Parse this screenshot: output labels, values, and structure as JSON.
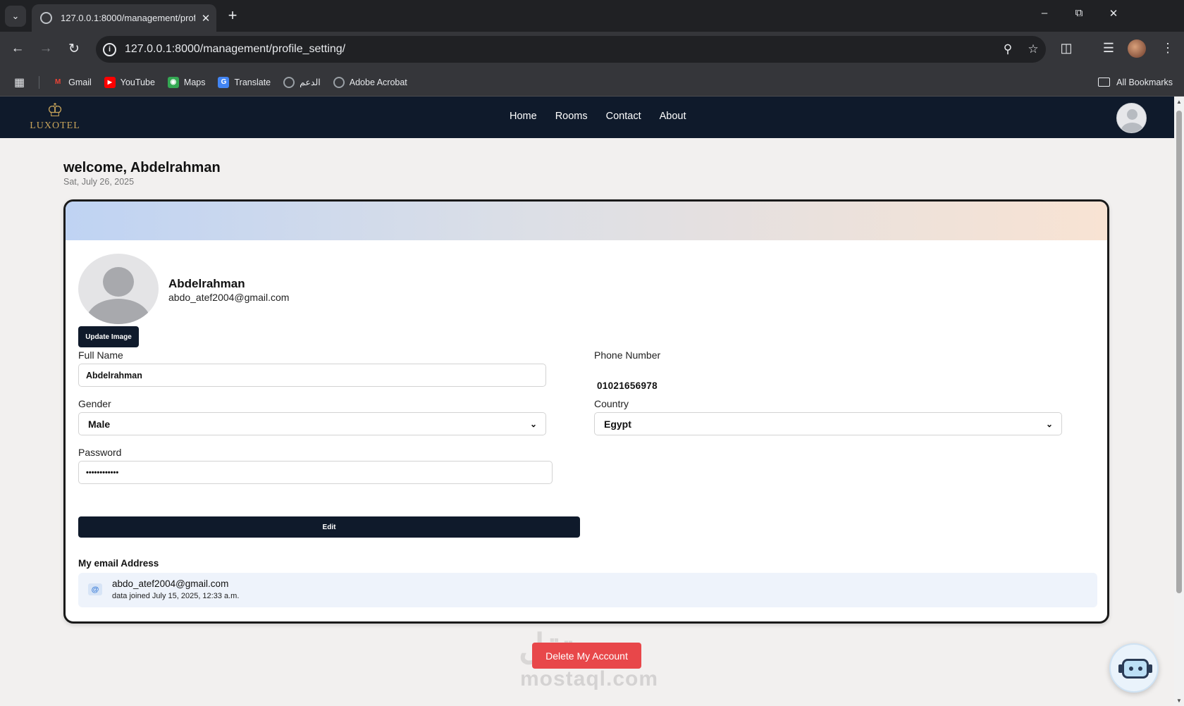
{
  "browser": {
    "tab_title": "127.0.0.1:8000/management/profile_setting/",
    "url": "127.0.0.1:8000/management/profile_setting/",
    "bookmarks": [
      {
        "label": "Gmail",
        "icon": "gmail-icon",
        "color": "#ea4335"
      },
      {
        "label": "YouTube",
        "icon": "youtube-icon",
        "color": "#ff0000"
      },
      {
        "label": "Maps",
        "icon": "maps-icon",
        "color": "#34a853"
      },
      {
        "label": "Translate",
        "icon": "translate-icon",
        "color": "#4285f4"
      },
      {
        "label": "الدعم",
        "icon": "globe-icon",
        "color": "#9aa0a6"
      },
      {
        "label": "Adobe Acrobat",
        "icon": "globe-icon",
        "color": "#9aa0a6"
      }
    ],
    "all_bookmarks": "All Bookmarks"
  },
  "site": {
    "logo_text": "LUXOTEL",
    "nav": [
      "Home",
      "Rooms",
      "Contact",
      "About"
    ],
    "brand_color": "#0f1a2b",
    "accent_color": "#c8a45a"
  },
  "profile": {
    "welcome": "welcome, Abdelrahman",
    "date": "Sat, July 26, 2025",
    "name": "Abdelrahman",
    "email": "abdo_atef2004@gmail.com",
    "update_image_label": "Update Image",
    "full_name_label": "Full Name",
    "full_name_value": "Abdelrahman",
    "phone_label": "Phone Number",
    "phone_value": "01021656978",
    "gender_label": "Gender",
    "gender_value": "Male",
    "country_label": "Country",
    "country_value": "Egypt",
    "password_label": "Password",
    "password_value": "••••••••••••",
    "edit_label": "Edit",
    "email_section_title": "My email Address",
    "email_joined": "data joined July 15, 2025, 12:33 a.m.",
    "delete_label": "Delete My Account",
    "delete_color": "#e8474a"
  },
  "watermark": {
    "line1": "مستقل",
    "line2": "mostaql.com"
  }
}
